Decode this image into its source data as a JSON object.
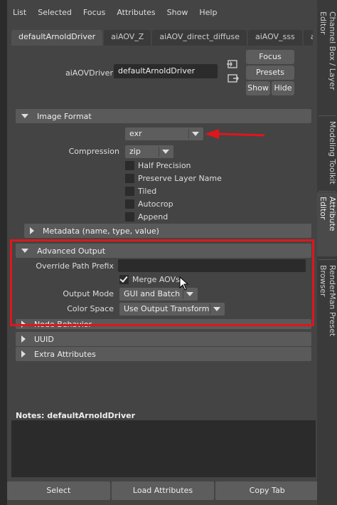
{
  "menu": [
    "List",
    "Selected",
    "Focus",
    "Attributes",
    "Show",
    "Help"
  ],
  "tabs": [
    "defaultArnoldDriver",
    "aiAOV_Z",
    "aiAOV_direct_diffuse",
    "aiAOV_sss",
    "a"
  ],
  "driver": {
    "label": "aiAOVDriver:",
    "value": "defaultArnoldDriver"
  },
  "buttons": {
    "focus": "Focus",
    "presets": "Presets",
    "show": "Show",
    "hide": "Hide"
  },
  "image_format": {
    "title": "Image Format",
    "format_value": "exr",
    "compression_label": "Compression",
    "compression_value": "zip",
    "checkboxes": [
      {
        "label": "Half Precision",
        "checked": false
      },
      {
        "label": "Preserve Layer Name",
        "checked": false
      },
      {
        "label": "Tiled",
        "checked": false
      },
      {
        "label": "Autocrop",
        "checked": false
      },
      {
        "label": "Append",
        "checked": false
      }
    ],
    "metadata_title": "Metadata (name, type, value)"
  },
  "advanced_output": {
    "title": "Advanced Output",
    "override_label": "Override Path Prefix",
    "override_value": "",
    "merge_label": "Merge AOVs",
    "merge_checked": true,
    "output_mode_label": "Output Mode",
    "output_mode_value": "GUI and Batch",
    "color_space_label": "Color Space",
    "color_space_value": "Use Output Transform"
  },
  "sections": {
    "node_behavior": "Node Behavior",
    "uuid": "UUID",
    "extra": "Extra Attributes"
  },
  "notes": {
    "label": "Notes:  defaultArnoldDriver"
  },
  "bottom": {
    "select": "Select",
    "load": "Load Attributes",
    "copy": "Copy Tab"
  },
  "side_tabs": [
    {
      "label": "Channel Box / Layer Editor"
    },
    {
      "label": "Modeling Toolkit"
    },
    {
      "label": "Attribute Editor"
    },
    {
      "label": "RenderMan Preset Browser"
    }
  ],
  "colors": {
    "highlight": "#e0161b",
    "background": "#444444"
  }
}
